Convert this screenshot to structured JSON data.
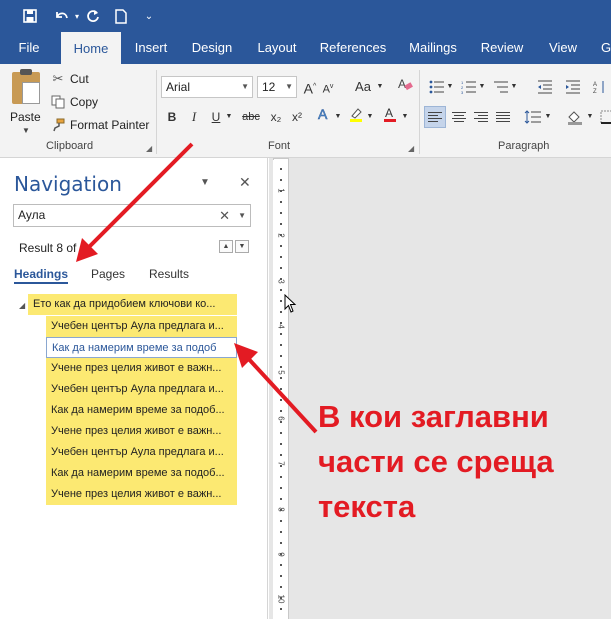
{
  "ribbon": {
    "tabs": [
      "File",
      "Home",
      "Insert",
      "Design",
      "Layout",
      "References",
      "Mailings",
      "Review",
      "View",
      "G"
    ],
    "active_tab": "Home",
    "clipboard": {
      "paste": "Paste",
      "cut": "Cut",
      "copy": "Copy",
      "format_painter": "Format Painter",
      "group_label": "Clipboard"
    },
    "font": {
      "font_name": "Arial",
      "font_size": "12",
      "bold": "B",
      "italic": "I",
      "underline": "U",
      "strikethrough": "abc",
      "subscript": "x₂",
      "superscript": "x²",
      "change_case": "Aa",
      "grow": "A",
      "shrink": "A",
      "group_label": "Font"
    },
    "paragraph": {
      "group_label": "Paragraph"
    }
  },
  "navigation": {
    "title": "Navigation",
    "search_value": "Аула",
    "result_text": "Result 8 of",
    "tabs": [
      "Headings",
      "Pages",
      "Results"
    ],
    "active_tab": "Headings",
    "headings": [
      {
        "text": "Ето как да придобием ключови ко...",
        "level": 1,
        "selected": false
      },
      {
        "text": "Учебен център Аула предлага и...",
        "level": 2,
        "selected": false
      },
      {
        "text": "Как да намерим време за подоб",
        "level": 2,
        "selected": true
      },
      {
        "text": "Учене през целия живот е важн...",
        "level": 2,
        "selected": false
      },
      {
        "text": "Учебен център Аула предлага и...",
        "level": 2,
        "selected": false
      },
      {
        "text": "Как да намерим време за подоб...",
        "level": 2,
        "selected": false
      },
      {
        "text": "Учене през целия живот е важн...",
        "level": 2,
        "selected": false
      },
      {
        "text": "Учебен център Аула предлага и...",
        "level": 2,
        "selected": false
      },
      {
        "text": "Как да намерим време за подоб...",
        "level": 2,
        "selected": false
      },
      {
        "text": "Учене през целия живот е важн...",
        "level": 2,
        "selected": false
      }
    ]
  },
  "ruler": {
    "numbers": [
      "1",
      "2",
      "3",
      "4",
      "5",
      "6",
      "7",
      "8",
      "9",
      "10"
    ],
    "corner": "L"
  },
  "annotation": {
    "text_lines": [
      "В кои заглавни",
      "части се среща",
      "текста"
    ],
    "color": "#e31b23"
  },
  "colors": {
    "accent": "#2b579a",
    "highlight": "#fce972"
  }
}
